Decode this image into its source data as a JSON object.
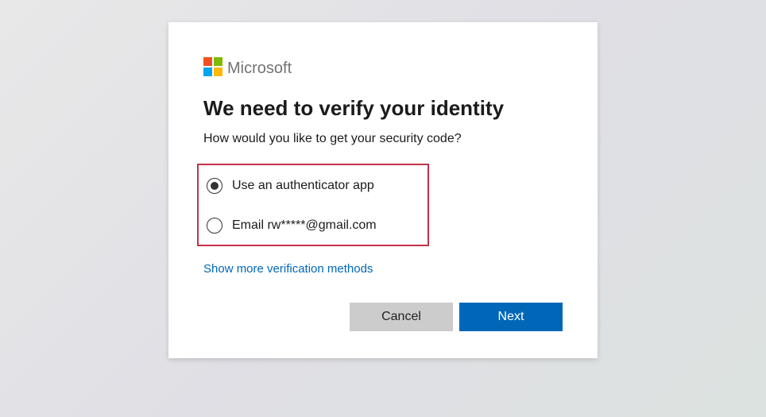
{
  "brand": {
    "name": "Microsoft"
  },
  "title": "We need to verify your identity",
  "subtitle": "How would you like to get your security code?",
  "options": [
    {
      "label": "Use an authenticator app",
      "selected": true
    },
    {
      "label": "Email rw*****@gmail.com",
      "selected": false
    }
  ],
  "more_link": "Show more verification methods",
  "buttons": {
    "cancel": "Cancel",
    "next": "Next"
  },
  "colors": {
    "primary": "#0067b8",
    "highlight_border": "#c4314b"
  }
}
